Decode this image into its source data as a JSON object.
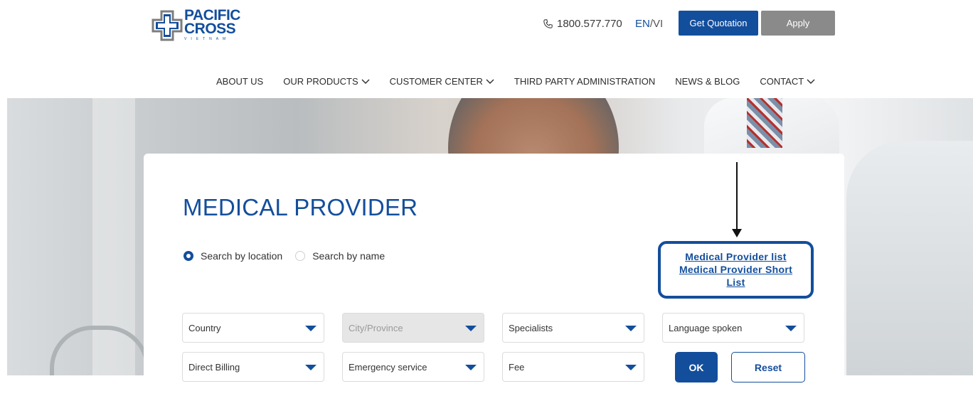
{
  "header": {
    "logo_line1": "PACIFIC",
    "logo_line2": "CROSS",
    "logo_sub": "VIETNAM",
    "phone": "1800.577.770",
    "lang_en": "EN",
    "lang_sep": "/",
    "lang_vi": "VI",
    "quote_button": "Get Quotation",
    "apply_button": "Apply"
  },
  "nav": {
    "items": [
      {
        "label": "ABOUT US",
        "has_dropdown": false
      },
      {
        "label": "OUR PRODUCTS",
        "has_dropdown": true
      },
      {
        "label": "CUSTOMER CENTER",
        "has_dropdown": true
      },
      {
        "label": "THIRD PARTY ADMINISTRATION",
        "has_dropdown": false
      },
      {
        "label": "NEWS & BLOG",
        "has_dropdown": false
      },
      {
        "label": "CONTACT",
        "has_dropdown": true
      }
    ]
  },
  "main": {
    "title": "MEDICAL PROVIDER",
    "search_modes": [
      {
        "label": "Search by location",
        "checked": true
      },
      {
        "label": "Search by name",
        "checked": false
      }
    ],
    "links": {
      "provider_list": "Medical Provider list",
      "short_list_line1": "Medical Provider Short",
      "short_list_line2": "List"
    },
    "filters": {
      "country": "Country",
      "city": "City/Province",
      "specialists": "Specialists",
      "language": "Language spoken",
      "direct_billing": "Direct Billing",
      "emergency": "Emergency service",
      "fee": "Fee"
    },
    "ok_button": "OK",
    "reset_button": "Reset"
  },
  "colors": {
    "brand": "#134e9c",
    "apply_bg": "#8a8a8a",
    "disabled_bg": "#e6e6e6"
  }
}
